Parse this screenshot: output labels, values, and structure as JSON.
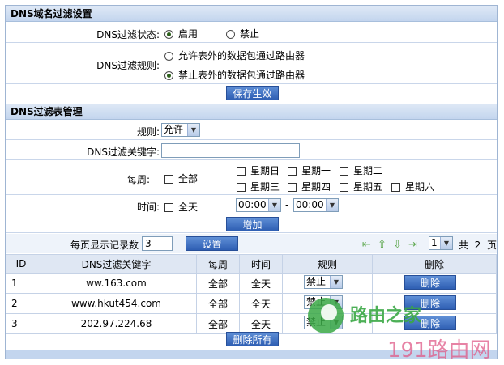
{
  "section1": {
    "title": "DNS域名过滤设置",
    "status_label": "DNS过滤状态:",
    "status_on": "启用",
    "status_off": "禁止",
    "rule_label": "DNS过滤规则:",
    "rule_allow": "允许表外的数据包通过路由器",
    "rule_deny": "禁止表外的数据包通过路由器",
    "save_label": "保存生效"
  },
  "section2": {
    "title": "DNS过滤表管理",
    "rule_label": "规则:",
    "rule_value": "允许",
    "keyword_label": "DNS过滤关键字:",
    "keyword_value": "",
    "week_label": "每周:",
    "all_label": "全部",
    "days": [
      "星期日",
      "星期一",
      "星期二",
      "星期三",
      "星期四",
      "星期五",
      "星期六"
    ],
    "time_label": "时间:",
    "allday_label": "全天",
    "time_from": "00:00",
    "time_sep": "-",
    "time_to": "00:00",
    "add_label": "增加"
  },
  "pager": {
    "per_page_label": "每页显示记录数",
    "per_page_value": "3",
    "set_label": "设置",
    "page_value": "1",
    "total_prefix": "共",
    "total_pages": "2",
    "total_suffix": "页"
  },
  "table": {
    "headers": [
      "ID",
      "DNS过滤关键字",
      "每周",
      "时间",
      "规则",
      "删除"
    ],
    "rows": [
      {
        "id": "1",
        "keyword": "ww.163.com",
        "week": "全部",
        "time": "全天",
        "rule": "禁止",
        "del": "删除"
      },
      {
        "id": "2",
        "keyword": "www.hkut454.com",
        "week": "全部",
        "time": "全天",
        "rule": "禁止",
        "del": "删除"
      },
      {
        "id": "3",
        "keyword": "202.97.224.68",
        "week": "全部",
        "time": "全天",
        "rule": "禁止",
        "del": "删除"
      }
    ],
    "delete_all_label": "删除所有"
  },
  "watermark": {
    "logo_text": "路由之家",
    "site_text": "191路由网"
  },
  "colors": {
    "button": "#2e5eb3",
    "section_bg": "#c3d5ee",
    "watermark_green": "#3aa845",
    "watermark_pink": "#e05a87"
  }
}
